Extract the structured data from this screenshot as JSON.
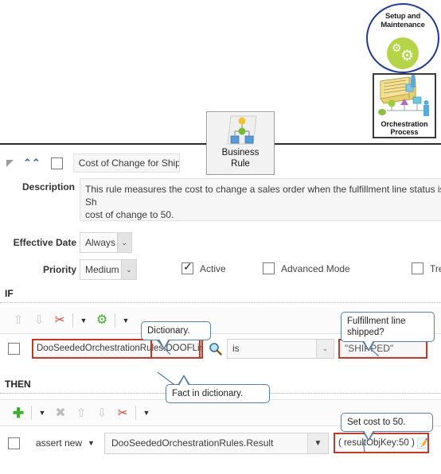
{
  "banner": {
    "setup_icon": {
      "label_line1": "Setup and",
      "label_line2": "Maintenance",
      "name": "setup-and-maintenance-icon",
      "gear_glyph_small": "⚙",
      "gear_glyph_large": "⚙",
      "border_color": "#1f3a93",
      "disc_color": "#b6d44a"
    },
    "orchestration_icon": {
      "label_line1": "Orchestration",
      "label_line2": "Process",
      "name": "orchestration-process-icon"
    },
    "business_rule_icon": {
      "label_line1": "Business",
      "label_line2": "Rule",
      "name": "business-rule-icon"
    }
  },
  "rule": {
    "name_value": "Cost of Change for Ship",
    "description_label": "Description",
    "description_value": "This rule measures the cost to change a sales order when the fulfillment line status is Sh\ncost of change to 50.",
    "effective_date_label": "Effective Date",
    "effective_date_value": "Always",
    "priority_label": "Priority",
    "priority_value": "Medium",
    "active_label": "Active",
    "active_checked": true,
    "advanced_mode_label": "Advanced Mode",
    "advanced_mode_checked": false,
    "tree_mode_label": "Tre",
    "tree_mode_checked": false,
    "row_checkbox_checked": false
  },
  "if_section": {
    "label": "IF",
    "toolbar": [
      {
        "name": "move-up-icon",
        "glyph": "⇧"
      },
      {
        "name": "move-down-icon",
        "glyph": "⇩"
      },
      {
        "name": "cut-icon",
        "glyph": "✂"
      },
      {
        "name": "cut-dropdown-caret-icon",
        "glyph": "▼"
      },
      {
        "name": "settings-gear-icon",
        "glyph": "⚙"
      },
      {
        "name": "settings-dropdown-caret-icon",
        "glyph": "▼"
      }
    ],
    "row_checked": false,
    "fact_value": "DooSeededOrchestrationRules.DOOFLine.s",
    "fact_prefix": "DooSeededOrchestrationRules.",
    "fact_highlight": "DOOFLine.s",
    "search_icon": "search-icon",
    "operator_value": "is",
    "compare_value": "\"SHIPPED\""
  },
  "then_section": {
    "label": "THEN",
    "toolbar": [
      {
        "name": "add-icon",
        "glyph": "✚"
      },
      {
        "name": "add-dropdown-caret-icon",
        "glyph": "▼"
      },
      {
        "name": "delete-icon",
        "glyph": "✖"
      },
      {
        "name": "move-up-icon",
        "glyph": "⇧"
      },
      {
        "name": "move-down-icon",
        "glyph": "⇩"
      },
      {
        "name": "cut-icon",
        "glyph": "✂"
      },
      {
        "name": "cut-dropdown-caret-icon",
        "glyph": "▼"
      }
    ],
    "row_checked": false,
    "action_value": "assert new",
    "object_value": "DooSeededOrchestrationRules.Result",
    "property_value": "( resultObjKey:50 )",
    "edit_icon": "pencil-edit-icon"
  },
  "callouts": {
    "dictionary": "Dictionary.",
    "fulfillment": "Fulfillment line shipped?",
    "fact_in_dictionary": "Fact in dictionary.",
    "set_cost": "Set cost to 50."
  },
  "colors": {
    "highlight_red": "#c0392b",
    "callout_blue": "#5b7fa6",
    "accent_green": "#4caf50"
  }
}
